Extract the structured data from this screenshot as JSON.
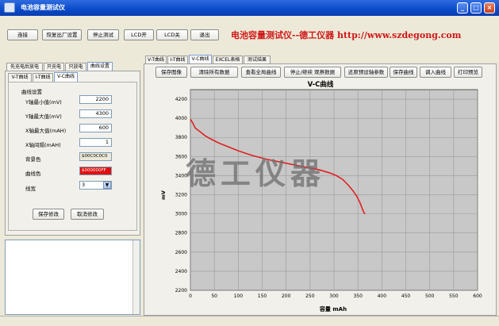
{
  "window": {
    "title": "电池容量测试仪"
  },
  "toolbar": {
    "buttons": [
      "连接",
      "恢复出厂设置",
      "停止测试",
      "LCD开",
      "LCD关",
      "退出"
    ]
  },
  "brand": "电池容量测试仪--德工仪器 http://www.szdegong.com",
  "left_tabs_top": [
    "先充电后放电",
    "只充电",
    "只放电",
    "曲线设置"
  ],
  "left_tabs_sub": [
    "V-T曲线",
    "I-T曲线",
    "V-C曲线"
  ],
  "settings": {
    "group_label": "曲线设置",
    "y_min_label": "Y轴最小值(mV)",
    "y_min": "2200",
    "y_max_label": "Y轴最大值(mV)",
    "y_max": "4300",
    "x_max_label": "X轴最大值(mAH)",
    "x_max": "600",
    "x_interval_label": "X轴间隔(mAH)",
    "x_interval": "1",
    "bg_color_label": "背景色",
    "bg_color": "$00C0C0C0",
    "curve_color_label": "曲线色",
    "curve_color": "$000000FF",
    "line_width_label": "线宽",
    "line_width": "3",
    "save_label": "保存修改",
    "cancel_label": "取消修改"
  },
  "right_tabs": [
    "V-T曲线",
    "I-T曲线",
    "V-C曲线",
    "EXCEL表格",
    "测试结果"
  ],
  "chart_toolbar": [
    "保存图像",
    "清除所有数据",
    "查看全局曲线",
    "停止/继续 观察数据",
    "还原预设轴参数",
    "保存曲线",
    "调入曲线",
    "打印预览"
  ],
  "watermark": "德工仪器",
  "colors": {
    "curve": "#E02020",
    "plot_bg": "#C8C8C8",
    "accent": "#D01818"
  },
  "chart_data": {
    "type": "line",
    "title": "V-C曲线",
    "xlabel": "容量 mAh",
    "ylabel": "mV",
    "xlim": [
      0,
      600
    ],
    "ylim": [
      2200,
      4300
    ],
    "x_ticks": [
      0,
      50,
      100,
      150,
      200,
      250,
      300,
      350,
      400,
      450,
      500,
      550,
      600
    ],
    "y_ticks": [
      2200,
      2400,
      2600,
      2800,
      3000,
      3200,
      3400,
      3600,
      3800,
      4000,
      4200
    ],
    "grid": true,
    "x": [
      0,
      5,
      10,
      20,
      30,
      40,
      60,
      80,
      100,
      130,
      160,
      200,
      240,
      270,
      290,
      305,
      318,
      330,
      340,
      348,
      354,
      358,
      361,
      363,
      365
    ],
    "y": [
      3990,
      3950,
      3900,
      3860,
      3820,
      3790,
      3740,
      3700,
      3660,
      3610,
      3570,
      3530,
      3490,
      3460,
      3430,
      3400,
      3360,
      3300,
      3240,
      3180,
      3120,
      3070,
      3030,
      3010,
      3000
    ]
  }
}
